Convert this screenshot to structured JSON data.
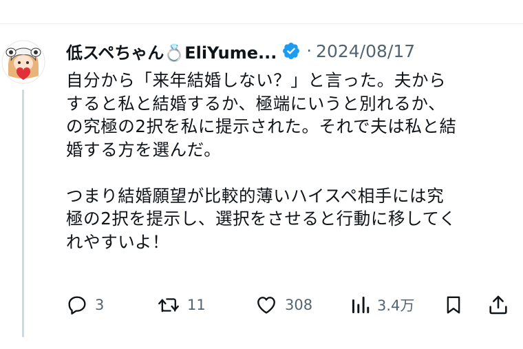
{
  "tweet": {
    "display_name": "低スペちゃん💍EliYume...",
    "separator": "·",
    "date": "2024/08/17",
    "paragraphs": [
      "自分から「来年結婚しない？」と言った。夫から\nすると私と結婚するか、極端にいうと別れるか、\nの究極の2択を私に提示された。それで夫は私と結\n婚する方を選んだ。",
      "つまり結婚願望が比較的薄いハイスペ相手には究\n極の2択を提示し、選択をさせると行動に移してく\nれやすいよ！"
    ]
  },
  "actions": {
    "replies": "3",
    "reposts": "11",
    "likes": "308",
    "views": "3.4万"
  },
  "icons": {
    "verified": "verified-badge-icon",
    "reply": "reply-icon",
    "repost": "repost-icon",
    "like": "heart-icon",
    "views": "views-icon",
    "bookmark": "bookmark-icon",
    "share": "share-icon"
  },
  "colors": {
    "verified_blue": "#1d9bf0",
    "secondary_text": "#536471",
    "thread_line": "#cfd9de"
  }
}
